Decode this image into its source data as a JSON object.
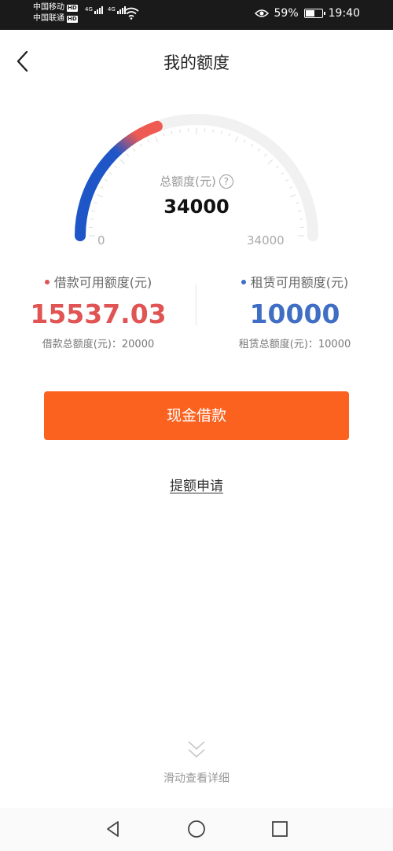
{
  "status_bar": {
    "carrier1": "中国移动",
    "carrier2": "中国联通",
    "hd_badge": "HD",
    "network_tag": "4G",
    "battery_percent": "59%",
    "battery_level": 0.59,
    "time": "19:40",
    "icons": [
      "signal-icon",
      "wifi-icon",
      "eye-icon",
      "battery-icon"
    ]
  },
  "header": {
    "title": "我的额度",
    "back_icon": "chevron-left-icon"
  },
  "gauge": {
    "label": "总额度(元)",
    "help_glyph": "?",
    "value": "34000",
    "min_label": "0",
    "max_label": "34000",
    "used_fraction": 0.39,
    "colors": {
      "start": "#1e56c8",
      "end": "#ef5a52",
      "track": "#f1f1f1",
      "ticks": "#dcdcdc"
    }
  },
  "loan": {
    "label": "借款可用额度(元)",
    "amount": "15537.03",
    "total": "借款总额度(元)：20000",
    "color": "#e05454"
  },
  "lease": {
    "label": "租赁可用额度(元)",
    "amount": "10000",
    "total": "租赁总额度(元)：10000",
    "color": "#3f6ec4"
  },
  "actions": {
    "cash_button": "现金借款",
    "button_color": "#fb6220",
    "increase_link": "提额申请"
  },
  "footer": {
    "scroll_hint": "滑动查看详细",
    "scroll_icon": "double-chevron-down-icon"
  },
  "system_nav": {
    "icons": [
      "back-triangle-icon",
      "home-circle-icon",
      "recents-square-icon"
    ]
  }
}
